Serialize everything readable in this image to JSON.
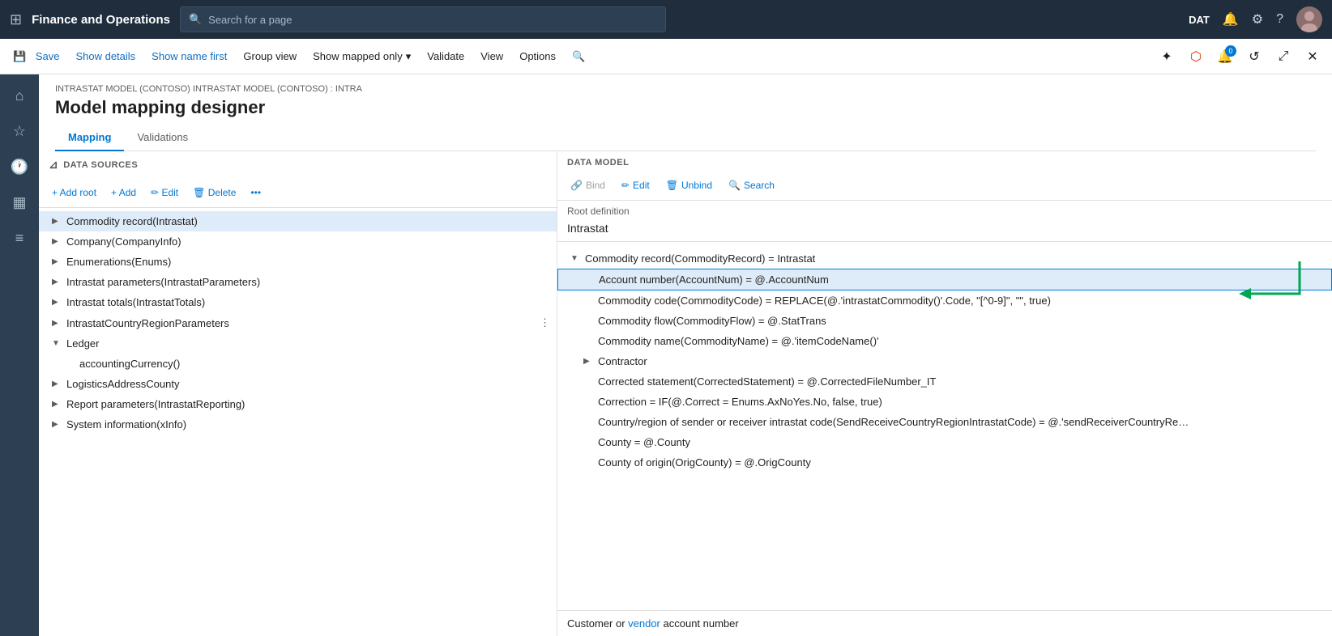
{
  "app": {
    "title": "Finance and Operations"
  },
  "search": {
    "placeholder": "Search for a page"
  },
  "topnav": {
    "env": "DAT",
    "icons": [
      "bell",
      "gear",
      "help",
      "avatar"
    ]
  },
  "commandbar": {
    "save": "Save",
    "show_details": "Show details",
    "show_name_first": "Show name first",
    "group_view": "Group view",
    "show_mapped_only": "Show mapped only",
    "validate": "Validate",
    "view": "View",
    "options": "Options"
  },
  "page": {
    "breadcrumb": "INTRASTAT MODEL (CONTOSO) INTRASTAT MODEL (CONTOSO) : INTRA",
    "title": "Model mapping designer",
    "tabs": [
      "Mapping",
      "Validations"
    ]
  },
  "left_pane": {
    "header": "DATA SOURCES",
    "toolbar": {
      "add_root": "+ Add root",
      "add": "+ Add",
      "edit": "✏ Edit",
      "delete": "🗑 Delete"
    },
    "tree": [
      {
        "label": "Commodity record(Intrastat)",
        "indent": 0,
        "expanded": false,
        "selected": true
      },
      {
        "label": "Company(CompanyInfo)",
        "indent": 0,
        "expanded": false,
        "selected": false
      },
      {
        "label": "Enumerations(Enums)",
        "indent": 0,
        "expanded": false,
        "selected": false
      },
      {
        "label": "Intrastat parameters(IntrastatParameters)",
        "indent": 0,
        "expanded": false,
        "selected": false
      },
      {
        "label": "Intrastat totals(IntrastatTotals)",
        "indent": 0,
        "expanded": false,
        "selected": false
      },
      {
        "label": "IntrastatCountryRegionParameters",
        "indent": 0,
        "expanded": false,
        "selected": false
      },
      {
        "label": "Ledger",
        "indent": 0,
        "expanded": true,
        "selected": false
      },
      {
        "label": "accountingCurrency()",
        "indent": 1,
        "expanded": false,
        "selected": false
      },
      {
        "label": "LogisticsAddressCounty",
        "indent": 0,
        "expanded": false,
        "selected": false
      },
      {
        "label": "Report parameters(IntrastatReporting)",
        "indent": 0,
        "expanded": false,
        "selected": false
      },
      {
        "label": "System information(xInfo)",
        "indent": 0,
        "expanded": false,
        "selected": false
      }
    ]
  },
  "right_pane": {
    "header": "DATA MODEL",
    "toolbar": {
      "bind": "Bind",
      "edit": "Edit",
      "unbind": "Unbind",
      "search": "Search"
    },
    "root_definition_label": "Root definition",
    "root_definition_value": "Intrastat",
    "tree": [
      {
        "label": "Commodity record(CommodityRecord) = Intrastat",
        "indent": 0,
        "expanded": true,
        "selected": false
      },
      {
        "label": "Account number(AccountNum) = @.AccountNum",
        "indent": 1,
        "expanded": false,
        "selected": true
      },
      {
        "label": "Commodity code(CommodityCode) = REPLACE(@.'intrastatCommodity()'.Code, \"[^0-9]\", \"\", true)",
        "indent": 1,
        "expanded": false,
        "selected": false
      },
      {
        "label": "Commodity flow(CommodityFlow) = @.StatTrans",
        "indent": 1,
        "expanded": false,
        "selected": false
      },
      {
        "label": "Commodity name(CommodityName) = @.'itemCodeName()'",
        "indent": 1,
        "expanded": false,
        "selected": false
      },
      {
        "label": "Contractor",
        "indent": 1,
        "expanded": false,
        "selected": false
      },
      {
        "label": "Corrected statement(CorrectedStatement) = @.CorrectedFileNumber_IT",
        "indent": 1,
        "expanded": false,
        "selected": false
      },
      {
        "label": "Correction = IF(@.Correct = Enums.AxNoYes.No, false, true)",
        "indent": 1,
        "expanded": false,
        "selected": false
      },
      {
        "label": "Country/region of sender or receiver intrastat code(SendReceiveCountryRegionIntrastatCode) = @.'sendReceiverCountryRe…",
        "indent": 1,
        "expanded": false,
        "selected": false
      },
      {
        "label": "County = @.County",
        "indent": 1,
        "expanded": false,
        "selected": false
      },
      {
        "label": "County of origin(OrigCounty) = @.OrigCounty",
        "indent": 1,
        "expanded": false,
        "selected": false
      }
    ]
  },
  "bottom_caption": {
    "text": "Customer or vendor account number",
    "link_word": "vendor"
  }
}
